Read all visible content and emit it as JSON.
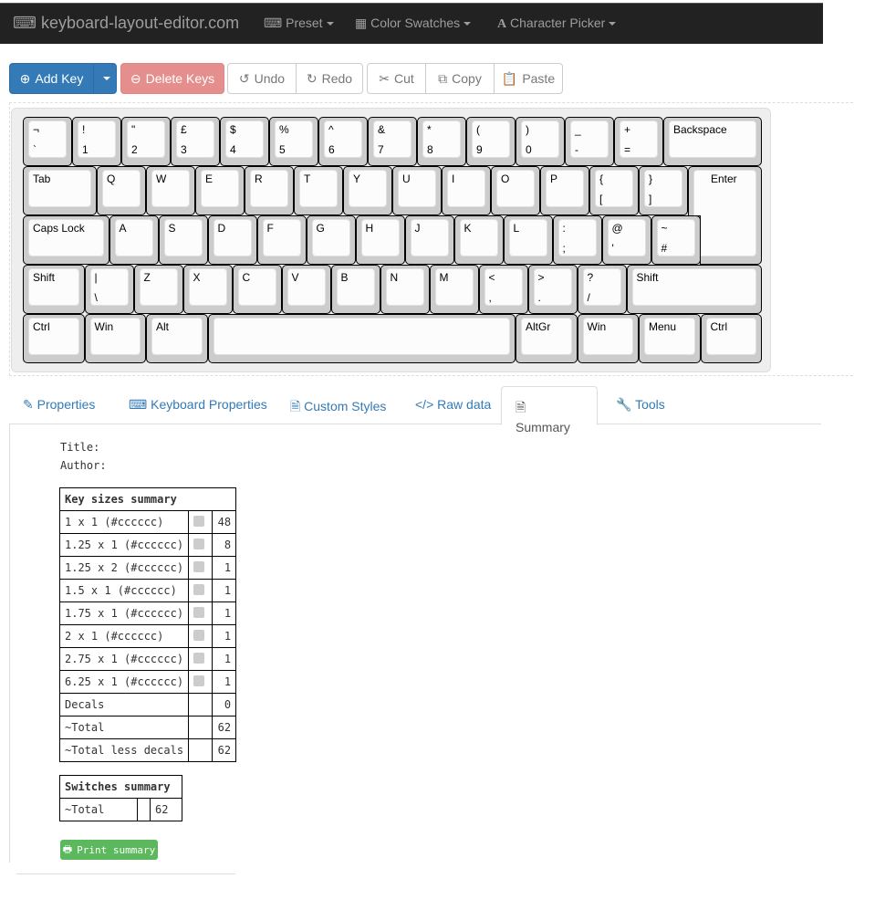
{
  "navbar": {
    "brand": "keyboard-layout-editor.com",
    "menus": [
      {
        "label": "Preset",
        "icon": "keyboard-icon"
      },
      {
        "label": "Color Swatches",
        "icon": "grid-icon"
      },
      {
        "label": "Character Picker",
        "icon": "font-icon"
      }
    ]
  },
  "toolbar": {
    "add_key": "Add Key",
    "delete_keys": "Delete Keys",
    "undo": "Undo",
    "redo": "Redo",
    "cut": "Cut",
    "copy": "Copy",
    "paste": "Paste"
  },
  "keyboard": {
    "rows": [
      [
        [
          "¬",
          "`"
        ],
        [
          "!",
          "1"
        ],
        [
          "\"",
          "2"
        ],
        [
          "£",
          "3"
        ],
        [
          "$",
          "4"
        ],
        [
          "%",
          "5"
        ],
        [
          "^",
          "6"
        ],
        [
          "&",
          "7"
        ],
        [
          "*",
          "8"
        ],
        [
          "(",
          "9"
        ],
        [
          ")",
          "0"
        ],
        [
          "_",
          "-"
        ],
        [
          "+",
          "="
        ],
        [
          "Backspace",
          ""
        ]
      ],
      [
        [
          "Tab",
          ""
        ],
        [
          "Q",
          ""
        ],
        [
          "W",
          ""
        ],
        [
          "E",
          ""
        ],
        [
          "R",
          ""
        ],
        [
          "T",
          ""
        ],
        [
          "Y",
          ""
        ],
        [
          "U",
          ""
        ],
        [
          "I",
          ""
        ],
        [
          "O",
          ""
        ],
        [
          "P",
          ""
        ],
        [
          "{",
          "["
        ],
        [
          "}",
          "]"
        ],
        [
          "Enter",
          ""
        ]
      ],
      [
        [
          "Caps Lock",
          ""
        ],
        [
          "A",
          ""
        ],
        [
          "S",
          ""
        ],
        [
          "D",
          ""
        ],
        [
          "F",
          ""
        ],
        [
          "G",
          ""
        ],
        [
          "H",
          ""
        ],
        [
          "J",
          ""
        ],
        [
          "K",
          ""
        ],
        [
          "L",
          ""
        ],
        [
          ":",
          ";"
        ],
        [
          "@",
          "'"
        ],
        [
          "~",
          "#"
        ]
      ],
      [
        [
          "Shift",
          ""
        ],
        [
          "|",
          "\\"
        ],
        [
          "Z",
          ""
        ],
        [
          "X",
          ""
        ],
        [
          "C",
          ""
        ],
        [
          "V",
          ""
        ],
        [
          "B",
          ""
        ],
        [
          "N",
          ""
        ],
        [
          "M",
          ""
        ],
        [
          "<",
          ","
        ],
        [
          ">",
          "."
        ],
        [
          "?",
          "/"
        ],
        [
          "Shift",
          ""
        ]
      ],
      [
        [
          "Ctrl",
          ""
        ],
        [
          "Win",
          ""
        ],
        [
          "Alt",
          ""
        ],
        [
          "",
          ""
        ],
        [
          "AltGr",
          ""
        ],
        [
          "Win",
          ""
        ],
        [
          "Menu",
          ""
        ],
        [
          "Ctrl",
          ""
        ]
      ]
    ]
  },
  "tabs": [
    {
      "label": "Properties",
      "icon": "edit-icon"
    },
    {
      "label": "Keyboard Properties",
      "icon": "keyboard-icon"
    },
    {
      "label": "Custom Styles",
      "icon": "file-icon"
    },
    {
      "label": "Raw data",
      "icon": "code-icon"
    },
    {
      "label": "Summary",
      "icon": "file-text-icon",
      "active": true
    },
    {
      "label": "Tools",
      "icon": "wrench-icon"
    }
  ],
  "summary": {
    "title_label": "Title:",
    "author_label": "Author:",
    "key_sizes": {
      "header": "Key sizes summary",
      "rows": [
        {
          "label": "1 x 1 (#cccccc)",
          "color": "#cccccc",
          "count": "48"
        },
        {
          "label": "1.25 x 1 (#cccccc)",
          "color": "#cccccc",
          "count": "8"
        },
        {
          "label": "1.25 x 2 (#cccccc)",
          "color": "#cccccc",
          "count": "1"
        },
        {
          "label": "1.5 x 1 (#cccccc)",
          "color": "#cccccc",
          "count": "1"
        },
        {
          "label": "1.75 x 1 (#cccccc)",
          "color": "#cccccc",
          "count": "1"
        },
        {
          "label": "2 x 1 (#cccccc)",
          "color": "#cccccc",
          "count": "1"
        },
        {
          "label": "2.75 x 1 (#cccccc)",
          "color": "#cccccc",
          "count": "1"
        },
        {
          "label": "6.25 x 1 (#cccccc)",
          "color": "#cccccc",
          "count": "1"
        },
        {
          "label": "Decals",
          "count": "0"
        },
        {
          "label": "~Total",
          "count": "62"
        },
        {
          "label": "~Total less decals",
          "count": "62"
        }
      ]
    },
    "switches": {
      "header": "Switches summary",
      "rows": [
        {
          "label": "~Total",
          "count": "62"
        }
      ]
    },
    "print_button": "Print summary"
  }
}
